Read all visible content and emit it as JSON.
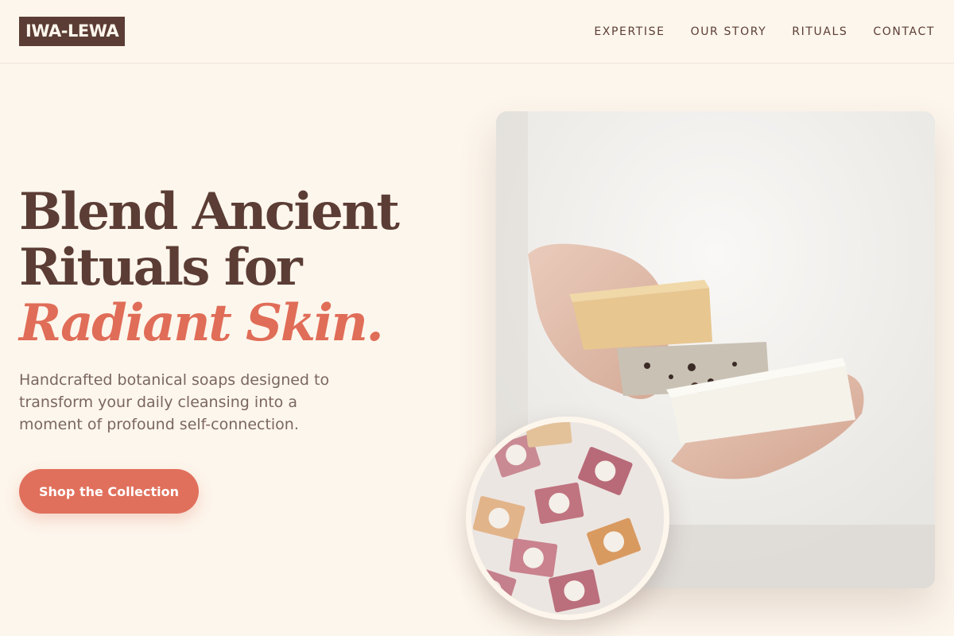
{
  "brand": {
    "logo": "IWA-LEWA"
  },
  "nav": {
    "items": [
      "EXPERTISE",
      "OUR STORY",
      "RITUALS",
      "CONTACT"
    ]
  },
  "hero": {
    "headline_line1": "Blend Ancient",
    "headline_line2": "Rituals for",
    "headline_accent": "Radiant Skin.",
    "subtext": "Handcrafted botanical soaps designed to transform your daily cleansing into a moment of profound self-connection.",
    "cta_label": "Shop the Collection"
  },
  "images": {
    "main": "hands-holding-soap-bars-photo",
    "circle": "soap-bars-flatlay-photo"
  },
  "colors": {
    "background": "#fdf6ec",
    "primary": "#5b3d35",
    "accent": "#e06d58",
    "body_text": "#7a6760"
  }
}
